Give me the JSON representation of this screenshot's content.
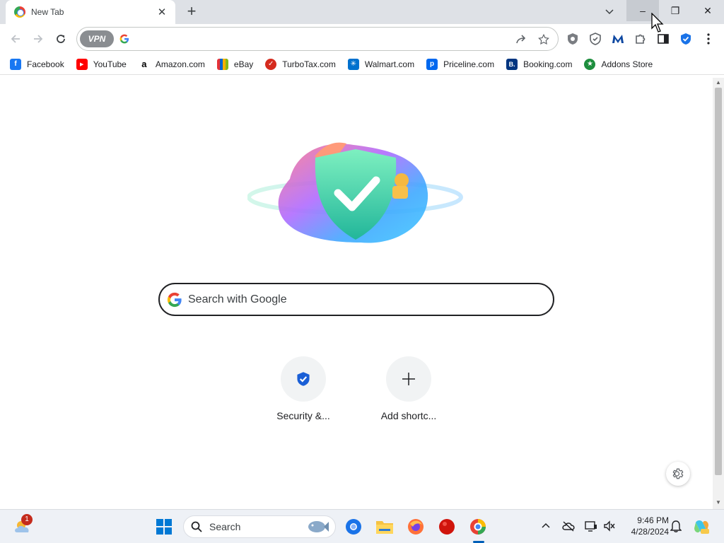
{
  "tab": {
    "title": "New Tab",
    "close": "✕"
  },
  "window": {
    "minimize": "–",
    "restore": "❐",
    "close": "✕"
  },
  "toolbar": {
    "vpn_label": "VPN"
  },
  "bookmarks": [
    {
      "label": "Facebook",
      "icon": "facebook-icon",
      "color": "#1877f2",
      "glyph": "f"
    },
    {
      "label": "YouTube",
      "icon": "youtube-icon",
      "color": "#ff0000",
      "glyph": "▶"
    },
    {
      "label": "Amazon.com",
      "icon": "amazon-icon",
      "color": "#ffffff",
      "glyph": "a"
    },
    {
      "label": "eBay",
      "icon": "ebay-icon",
      "color": "#444444",
      "glyph": "e"
    },
    {
      "label": "TurboTax.com",
      "icon": "turbotax-icon",
      "color": "#d52b1e",
      "glyph": "✓"
    },
    {
      "label": "Walmart.com",
      "icon": "walmart-icon",
      "color": "#0071ce",
      "glyph": "✳"
    },
    {
      "label": "Priceline.com",
      "icon": "priceline-icon",
      "color": "#0068ef",
      "glyph": "p"
    },
    {
      "label": "Booking.com",
      "icon": "booking-icon",
      "color": "#003580",
      "glyph": "B."
    },
    {
      "label": "Addons Store",
      "icon": "addons-store-icon",
      "color": "#1e8e3e",
      "glyph": "★"
    }
  ],
  "search": {
    "placeholder": "Search with Google"
  },
  "shortcuts": [
    {
      "label": "Security &...",
      "icon": "shield-icon"
    },
    {
      "label": "Add shortc...",
      "icon": "plus-icon"
    }
  ],
  "taskbar": {
    "search_label": "Search",
    "weather_badge": "1",
    "time": "9:46 PM",
    "date": "4/28/2024"
  },
  "colors": {
    "accent": "#1a73e8",
    "tabstrip": "#dee1e6",
    "taskbar": "#eef1f6"
  }
}
